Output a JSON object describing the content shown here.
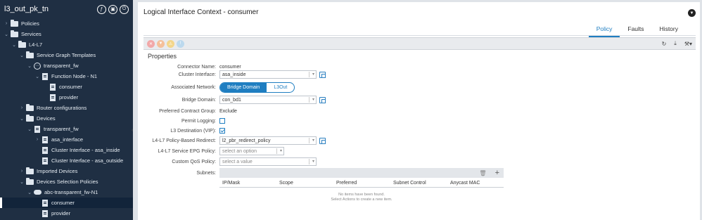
{
  "sidebar": {
    "title": "l3_out_pk_tn",
    "header_icons": [
      "function-icon",
      "lock-icon",
      "power-icon"
    ],
    "tree": [
      {
        "label": "Policies",
        "depth": 1,
        "icon": "folder-icon",
        "expand": "collapsed"
      },
      {
        "label": "Services",
        "depth": 1,
        "icon": "folder-icon",
        "expand": "expanded"
      },
      {
        "label": "L4-L7",
        "depth": 2,
        "icon": "folder-icon",
        "expand": "expanded"
      },
      {
        "label": "Service Graph Templates",
        "depth": 3,
        "icon": "folder-icon",
        "expand": "expanded"
      },
      {
        "label": "transparent_fw",
        "depth": 4,
        "icon": "graph-icon",
        "expand": "expanded"
      },
      {
        "label": "Function Node - N1",
        "depth": 5,
        "icon": "document-icon",
        "expand": "expanded"
      },
      {
        "label": "consumer",
        "depth": 6,
        "icon": "document-icon",
        "expand": "none"
      },
      {
        "label": "provider",
        "depth": 6,
        "icon": "document-icon",
        "expand": "none"
      },
      {
        "label": "Router configurations",
        "depth": 3,
        "icon": "folder-icon",
        "expand": "collapsed"
      },
      {
        "label": "Devices",
        "depth": 3,
        "icon": "folder-icon",
        "expand": "expanded"
      },
      {
        "label": "transparent_fw",
        "depth": 4,
        "icon": "document-icon",
        "expand": "expanded"
      },
      {
        "label": "asa_interface",
        "depth": 5,
        "icon": "document-icon",
        "expand": "collapsed"
      },
      {
        "label": "Cluster Interface - asa_inside",
        "depth": 5,
        "icon": "document-icon",
        "expand": "none"
      },
      {
        "label": "Cluster Interface - asa_outside",
        "depth": 5,
        "icon": "document-icon",
        "expand": "none"
      },
      {
        "label": "Imported Devices",
        "depth": 3,
        "icon": "folder-icon",
        "expand": "collapsed"
      },
      {
        "label": "Devices Selection Policies",
        "depth": 3,
        "icon": "folder-icon",
        "expand": "expanded"
      },
      {
        "label": "abc-transparent_fw-N1",
        "depth": 4,
        "icon": "cloud-icon",
        "expand": "expanded"
      },
      {
        "label": "consumer",
        "depth": 5,
        "icon": "document-icon",
        "expand": "none",
        "selected": true
      },
      {
        "label": "provider",
        "depth": 5,
        "icon": "document-icon",
        "expand": "none"
      }
    ]
  },
  "main": {
    "title": "Logical Interface Context - consumer",
    "tabs": [
      {
        "label": "Policy",
        "active": true
      },
      {
        "label": "Faults",
        "active": false
      },
      {
        "label": "History",
        "active": false
      }
    ],
    "severity_icons": [
      {
        "name": "critical-icon",
        "color": "#f2a8a8"
      },
      {
        "name": "major-icon",
        "color": "#f5c09a"
      },
      {
        "name": "minor-icon",
        "color": "#f3d68a"
      },
      {
        "name": "warning-icon",
        "color": "#bcd9ee"
      }
    ],
    "toolbar_right": [
      "refresh-icon",
      "download-icon",
      "tools-icon"
    ],
    "properties_title": "Properties",
    "fields": {
      "connector_name": {
        "label": "Connector Name:",
        "value": "consumer"
      },
      "cluster_interface": {
        "label": "Cluster Interface:",
        "value": "asa_inside"
      },
      "associated_network": {
        "label": "Associated Network:",
        "options": [
          "Bridge Domain",
          "L3Out"
        ],
        "selected": "Bridge Domain"
      },
      "bridge_domain": {
        "label": "Bridge Domain:",
        "value": "con_bd1"
      },
      "preferred_contract_group": {
        "label": "Preferred Contract Group:",
        "value": "Exclude"
      },
      "permit_logging": {
        "label": "Permit Logging:",
        "checked": false
      },
      "l3_destination": {
        "label": "L3 Destination (VIP):",
        "checked": true
      },
      "pbr": {
        "label": "L4-L7 Policy-Based Redirect:",
        "value": "l2_pbr_redirect_policy"
      },
      "service_epg": {
        "label": "L4-L7 Service EPG Policy:",
        "placeholder": "select an option"
      },
      "custom_qos": {
        "label": "Custom QoS Policy:",
        "placeholder": "select a value"
      },
      "subnets": {
        "label": "Subnets:"
      }
    },
    "subnets_table": {
      "columns": [
        "IP/Mask",
        "Scope",
        "Preferred",
        "Subnet Control",
        "Anycast MAC"
      ],
      "empty_line1": "No items have been found.",
      "empty_line2": "Select Actions to create a new item."
    }
  },
  "colors": {
    "sidebar_bg": "#1f2f43",
    "accent": "#1f7ec1"
  }
}
